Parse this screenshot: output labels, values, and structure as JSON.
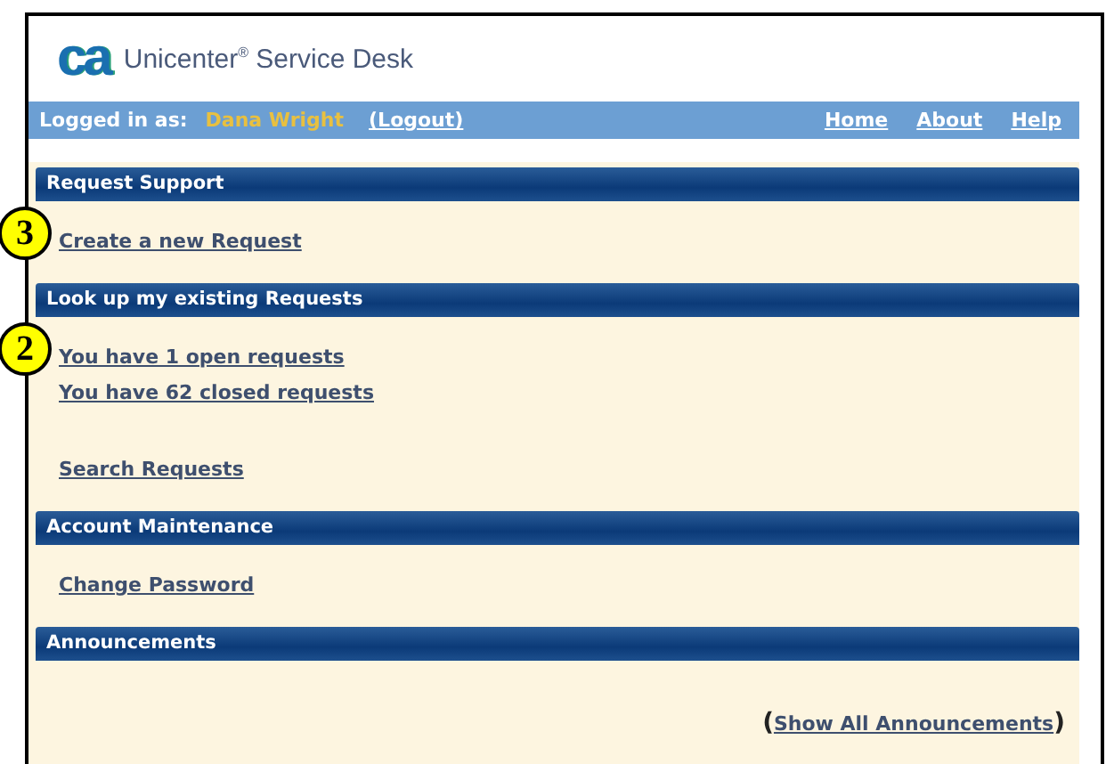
{
  "header": {
    "logo": "ca",
    "title": "Unicenter$^{®}$ Service Desk"
  },
  "nav": {
    "logged_in_label": "Logged in as:",
    "user": "Dana Wright",
    "logout": "(Logout)",
    "links": [
      "Home",
      "About",
      "Help"
    ]
  },
  "sections": [
    {
      "title": "Request Support",
      "groups": [
        [
          {
            "text": "Create a new Request",
            "callout": "3"
          }
        ]
      ]
    },
    {
      "title": "Look up my existing Requests",
      "groups": [
        [
          {
            "text": "You have 1 open requests",
            "callout": "2"
          },
          {
            "text": "You have 62 closed requests"
          }
        ],
        [
          {
            "text": "Search Requests"
          }
        ]
      ]
    },
    {
      "title": "Account Maintenance",
      "groups": [
        [
          {
            "text": "Change Password"
          }
        ]
      ]
    },
    {
      "title": "Announcements",
      "footer": {
        "open": "(",
        "link": "Show All Announcements",
        "close": ")"
      }
    }
  ]
}
